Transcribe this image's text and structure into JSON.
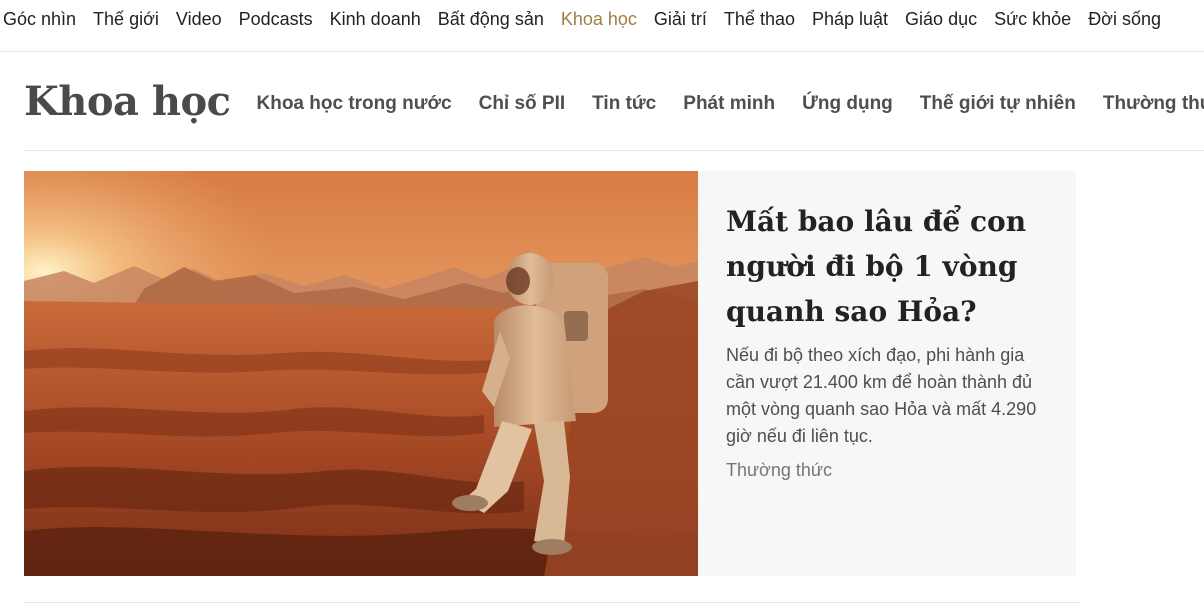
{
  "topnav": {
    "items": [
      {
        "label": "Góc nhìn"
      },
      {
        "label": "Thế giới"
      },
      {
        "label": "Video"
      },
      {
        "label": "Podcasts"
      },
      {
        "label": "Kinh doanh"
      },
      {
        "label": "Bất động sản"
      },
      {
        "label": "Khoa học",
        "active": true
      },
      {
        "label": "Giải trí"
      },
      {
        "label": "Thể thao"
      },
      {
        "label": "Pháp luật"
      },
      {
        "label": "Giáo dục"
      },
      {
        "label": "Sức khỏe"
      },
      {
        "label": "Đời sống"
      }
    ],
    "active_color": "#9f7e3e"
  },
  "section": {
    "title": "Khoa học",
    "subnav": [
      {
        "label": "Khoa học trong nước"
      },
      {
        "label": "Chỉ số PII"
      },
      {
        "label": "Tin tức"
      },
      {
        "label": "Phát minh"
      },
      {
        "label": "Ứng dụng"
      },
      {
        "label": "Thế giới tự nhiên"
      },
      {
        "label": "Thường thức"
      }
    ]
  },
  "feature": {
    "title": "Mất bao lâu để con người đi bộ 1 vòng quanh sao Hỏa?",
    "description": "Nếu đi bộ theo xích đạo, phi hành gia cần vượt 21.400 km để hoàn thành đủ một vòng quanh sao Hỏa và mất 4.290 giờ nếu đi liên tục.",
    "category": "Thường thức",
    "image_icon": "astronaut-on-mars-image"
  }
}
